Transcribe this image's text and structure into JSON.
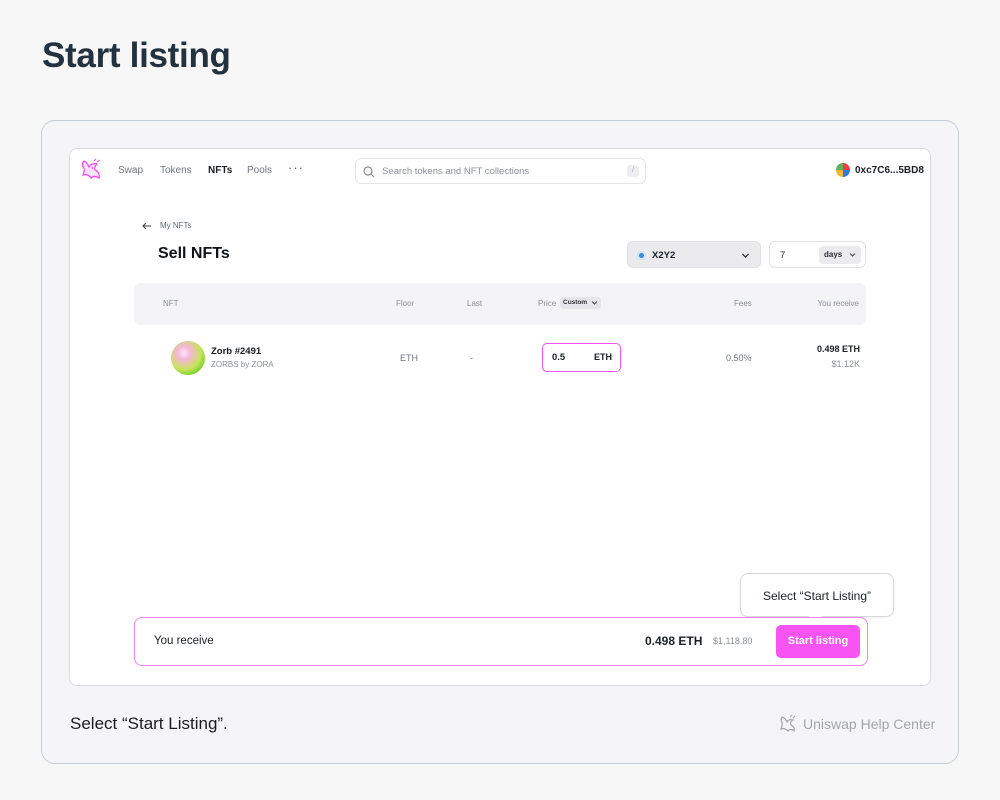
{
  "page": {
    "title": "Start listing",
    "caption": "Select “Start Listing”.",
    "help_center": "Uniswap Help Center"
  },
  "nav": {
    "links": [
      "Swap",
      "Tokens",
      "NFTs",
      "Pools"
    ],
    "active": "NFTs",
    "more": "···",
    "search_placeholder": "Search tokens and NFT collections",
    "search_shortcut": "/",
    "account": "0xc7C6...5BD8"
  },
  "header": {
    "back_label": "My NFTs",
    "title": "Sell NFTs",
    "marketplace": "X2Y2",
    "duration_value": "7",
    "duration_unit": "days"
  },
  "table": {
    "columns": {
      "nft": "NFT",
      "floor": "Floor",
      "last": "Last",
      "price": "Price",
      "price_mode": "Custom",
      "fees": "Fees",
      "receive": "You receive"
    },
    "rows": [
      {
        "name": "Zorb #2491",
        "collection": "ZORBS by ZORA",
        "floor": "ETH",
        "last": "-",
        "price": "0.5",
        "price_unit": "ETH",
        "fees": "0.50%",
        "receive_eth": "0.498 ETH",
        "receive_usd": "$1.12K"
      }
    ]
  },
  "footer_bar": {
    "label": "You receive",
    "total_eth": "0.498 ETH",
    "total_usd": "$1,118.80",
    "button": "Start listing"
  },
  "tooltip": "Select “Start Listing”",
  "colors": {
    "accent": "#f754f3",
    "accent_border": "#f77ff5"
  }
}
